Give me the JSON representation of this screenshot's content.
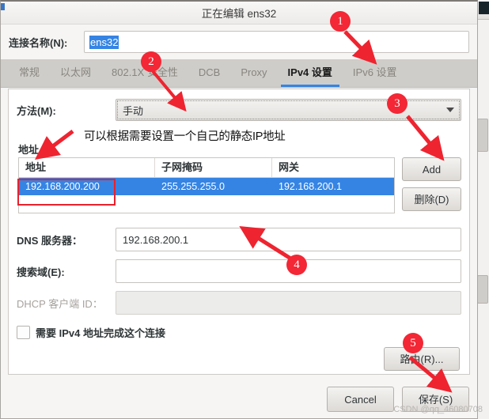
{
  "window": {
    "title": "正在编辑 ens32"
  },
  "connection": {
    "label": "连接名称(N):",
    "value": "ens32"
  },
  "tabs": [
    {
      "label": "常规",
      "active": false
    },
    {
      "label": "以太网",
      "active": false
    },
    {
      "label": "802.1X 安全性",
      "active": false
    },
    {
      "label": "DCB",
      "active": false
    },
    {
      "label": "Proxy",
      "active": false
    },
    {
      "label": "IPv4 设置",
      "active": true
    },
    {
      "label": "IPv6 设置",
      "active": false
    }
  ],
  "method": {
    "label": "方法(M):",
    "value": "手动"
  },
  "annotation_sentence": "可以根据需要设置一个自己的静态IP地址",
  "addresses": {
    "title": "地址",
    "columns": [
      "地址",
      "子网掩码",
      "网关"
    ],
    "rows": [
      [
        "192.168.200.200",
        "255.255.255.0",
        "192.168.200.1"
      ]
    ],
    "add_button": "Add",
    "delete_button": "删除(D)"
  },
  "dns": {
    "label": "DNS 服务器：",
    "value": "192.168.200.1"
  },
  "search_domains": {
    "label": "搜索域(E):",
    "value": ""
  },
  "dhcp_client_id": {
    "label": "DHCP 客户端 ID：",
    "value": ""
  },
  "require_ipv4": {
    "label": "需要 IPv4 地址完成这个连接",
    "checked": false
  },
  "routes_button": "路由(R)...",
  "footer": {
    "cancel": "Cancel",
    "save": "保存(S)"
  },
  "markers": {
    "m1": "1",
    "m2": "2",
    "m3": "3",
    "m4": "4",
    "m5": "5"
  },
  "watermark": "CSDN @qq_46080708",
  "colors": {
    "accent_blue": "#3584e4",
    "annotation_red": "#f32735",
    "tabbar_bg": "#cfcdc9"
  }
}
